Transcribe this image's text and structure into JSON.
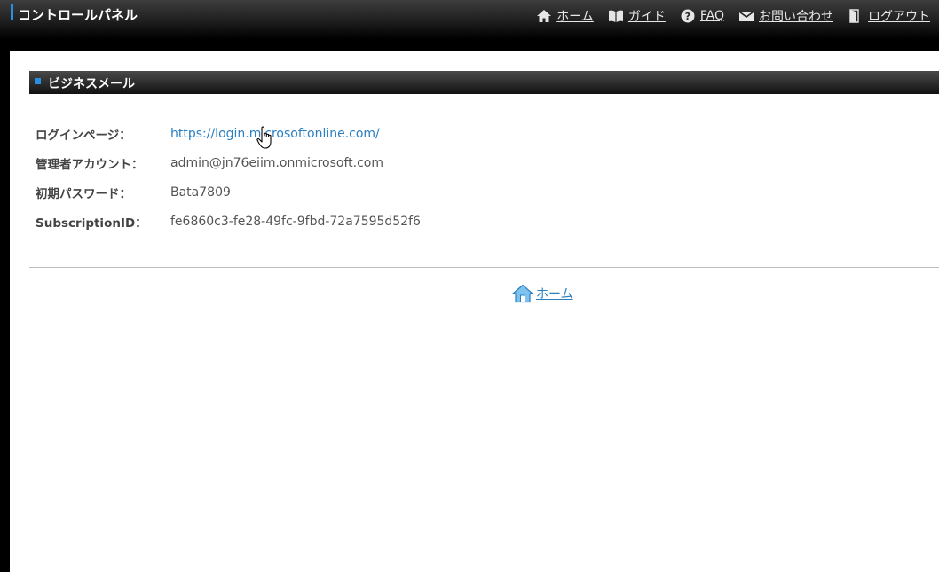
{
  "header": {
    "title": "コントロールパネル",
    "nav": [
      {
        "label": "ホーム",
        "icon": "home-icon"
      },
      {
        "label": "ガイド",
        "icon": "book-icon"
      },
      {
        "label": "FAQ",
        "icon": "question-icon"
      },
      {
        "label": "お問い合わせ",
        "icon": "mail-icon"
      },
      {
        "label": "ログアウト",
        "icon": "logout-icon"
      }
    ]
  },
  "section": {
    "title": "ビジネスメール",
    "rows": [
      {
        "label": "ログインページ：",
        "value": "https://login.microsoftonline.com/"
      },
      {
        "label": "管理者アカウント：",
        "value": "admin@jn76eiim.onmicrosoft.com"
      },
      {
        "label": "初期パスワード：",
        "value": "Bata7809"
      },
      {
        "label": "SubscriptionID：",
        "value": "fe6860c3-fe28-49fc-9fbd-72a7595d52f6"
      }
    ]
  },
  "footer": {
    "home_label": "ホーム"
  },
  "colors": {
    "accent": "#2a8fe0",
    "link": "#2a7fc1"
  }
}
